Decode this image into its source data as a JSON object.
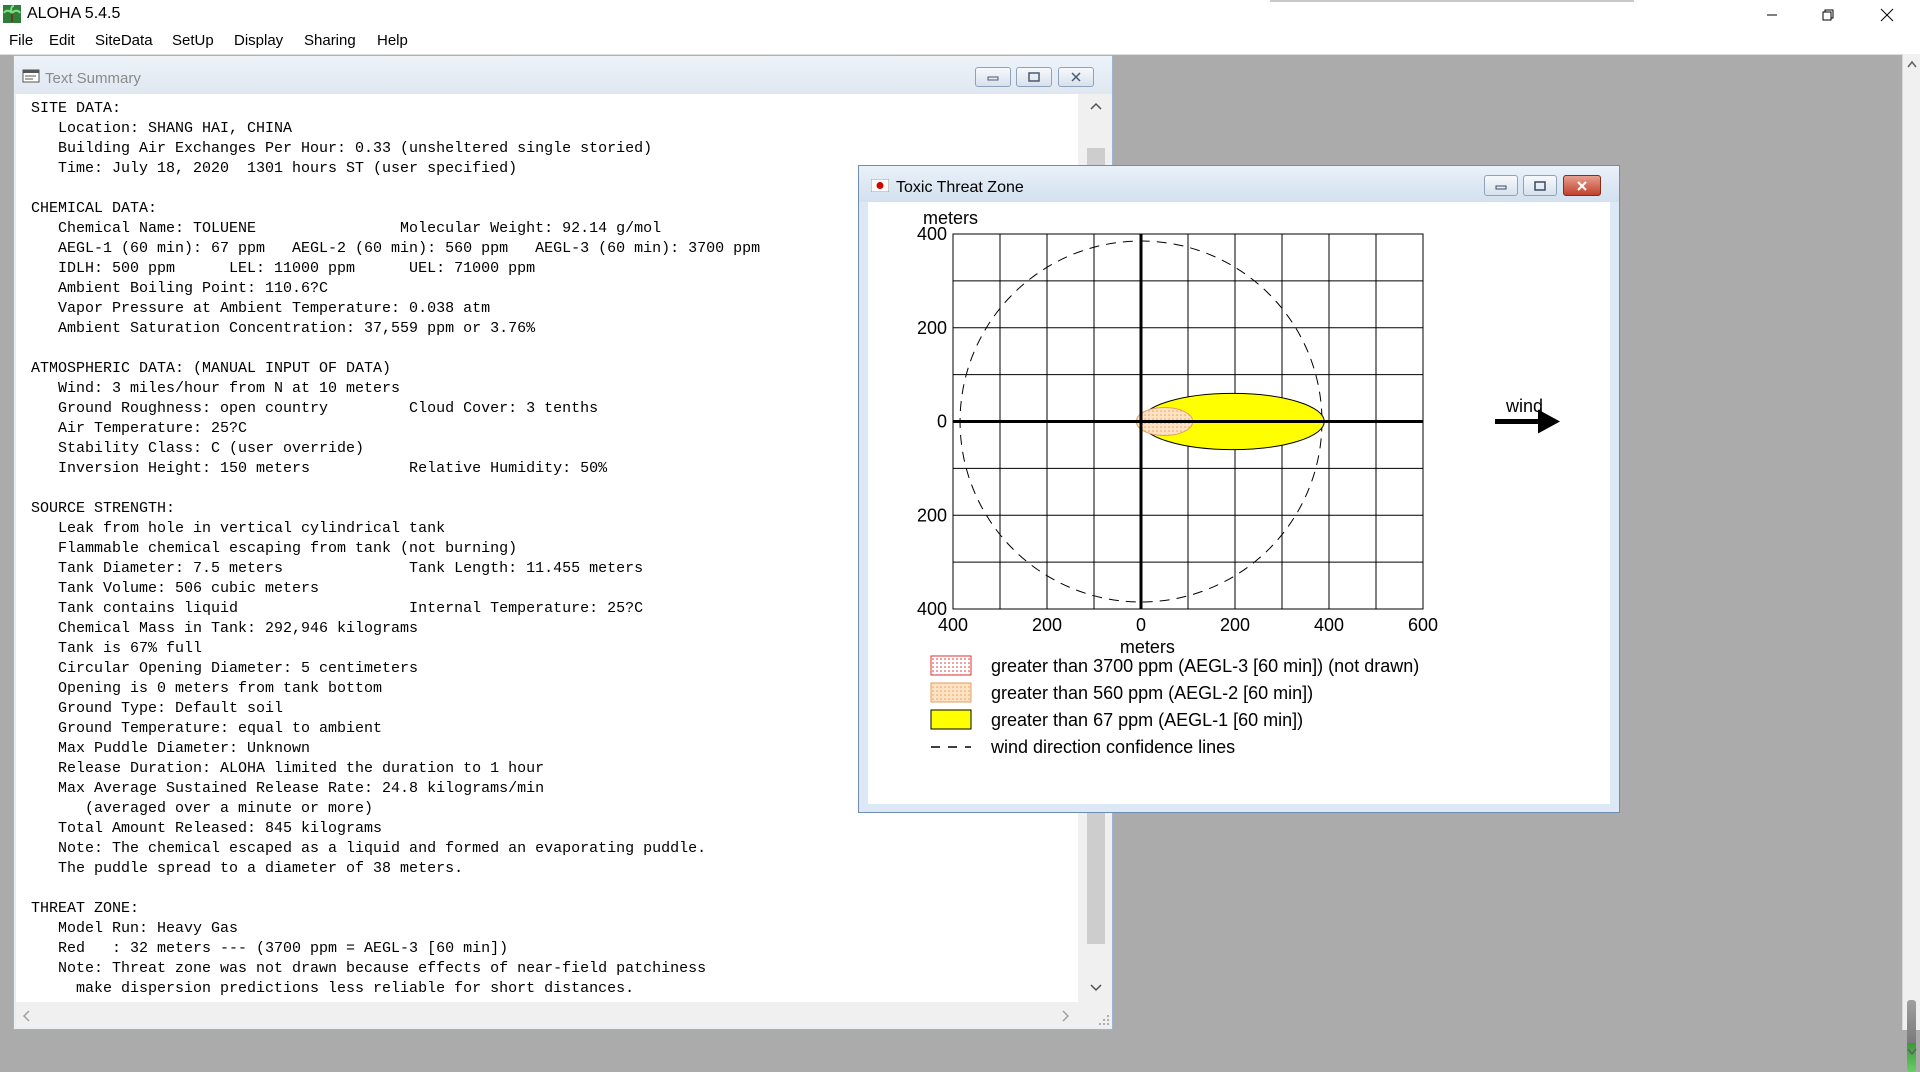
{
  "app": {
    "title": "ALOHA 5.4.5",
    "menu": [
      "File",
      "Edit",
      "SiteData",
      "SetUp",
      "Display",
      "Sharing",
      "Help"
    ]
  },
  "text_summary": {
    "title": "Text Summary",
    "lines": [
      "SITE DATA:",
      "   Location: SHANG HAI, CHINA",
      "   Building Air Exchanges Per Hour: 0.33 (unsheltered single storied)",
      "   Time: July 18, 2020  1301 hours ST (user specified)",
      "",
      "CHEMICAL DATA:",
      "   Chemical Name: TOLUENE                Molecular Weight: 92.14 g/mol",
      "   AEGL-1 (60 min): 67 ppm   AEGL-2 (60 min): 560 ppm   AEGL-3 (60 min): 3700 ppm",
      "   IDLH: 500 ppm      LEL: 11000 ppm      UEL: 71000 ppm",
      "   Ambient Boiling Point: 110.6?C",
      "   Vapor Pressure at Ambient Temperature: 0.038 atm",
      "   Ambient Saturation Concentration: 37,559 ppm or 3.76%",
      "",
      "ATMOSPHERIC DATA: (MANUAL INPUT OF DATA)",
      "   Wind: 3 miles/hour from N at 10 meters",
      "   Ground Roughness: open country         Cloud Cover: 3 tenths",
      "   Air Temperature: 25?C",
      "   Stability Class: C (user override)",
      "   Inversion Height: 150 meters           Relative Humidity: 50%",
      "",
      "SOURCE STRENGTH:",
      "   Leak from hole in vertical cylindrical tank",
      "   Flammable chemical escaping from tank (not burning)",
      "   Tank Diameter: 7.5 meters              Tank Length: 11.455 meters",
      "   Tank Volume: 506 cubic meters",
      "   Tank contains liquid                   Internal Temperature: 25?C",
      "   Chemical Mass in Tank: 292,946 kilograms",
      "   Tank is 67% full",
      "   Circular Opening Diameter: 5 centimeters",
      "   Opening is 0 meters from tank bottom",
      "   Ground Type: Default soil",
      "   Ground Temperature: equal to ambient",
      "   Max Puddle Diameter: Unknown",
      "   Release Duration: ALOHA limited the duration to 1 hour",
      "   Max Average Sustained Release Rate: 24.8 kilograms/min",
      "      (averaged over a minute or more)",
      "   Total Amount Released: 845 kilograms",
      "   Note: The chemical escaped as a liquid and formed an evaporating puddle.",
      "   The puddle spread to a diameter of 38 meters.",
      "",
      "THREAT ZONE:",
      "   Model Run: Heavy Gas",
      "   Red   : 32 meters --- (3700 ppm = AEGL-3 [60 min])",
      "   Note: Threat zone was not drawn because effects of near-field patchiness",
      "     make dispersion predictions less reliable for short distances."
    ]
  },
  "threat_zone": {
    "title": "Toxic Threat Zone",
    "y_axis_label": "meters",
    "x_axis_label": "meters",
    "y_ticks": [
      "400",
      "200",
      "0",
      "200",
      "400"
    ],
    "x_ticks": [
      "400",
      "200",
      "0",
      "200",
      "400",
      "600"
    ],
    "wind_label": "wind",
    "legend": [
      {
        "label": "greater than 3700 ppm (AEGL-3 [60 min]) (not drawn)",
        "swatch": "red-dotted"
      },
      {
        "label": "greater than 560 ppm (AEGL-2 [60 min])",
        "swatch": "orange-dotted"
      },
      {
        "label": "greater than 67 ppm (AEGL-1 [60 min])",
        "swatch": "yellow"
      },
      {
        "label": "wind direction confidence lines",
        "swatch": "dashed-line"
      }
    ],
    "colors": {
      "aegl1": "#ffff00",
      "aegl2": "#fbd9b4",
      "aegl3": "#ff6b6b",
      "grid": "#000000"
    }
  },
  "chart_data": {
    "type": "scatter",
    "xlim": [
      -400,
      600
    ],
    "ylim": [
      -400,
      400
    ],
    "zones": [
      {
        "name": "greater than 560 ppm (AEGL-2 [60 min])",
        "x_range": [
          -10,
          110
        ],
        "half_width": 30
      },
      {
        "name": "greater than 67 ppm (AEGL-1 [60 min])",
        "x_range": [
          0,
          390
        ],
        "half_width": 60
      }
    ],
    "confidence_circle_radius": 385
  }
}
